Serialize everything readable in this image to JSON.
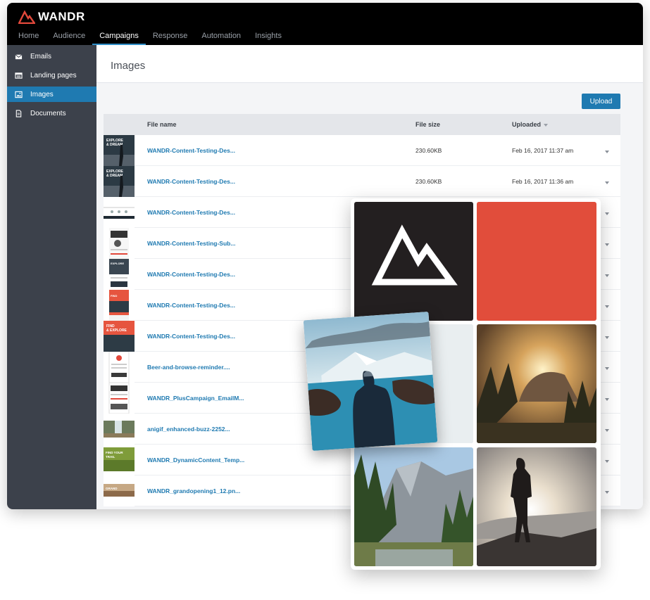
{
  "app": {
    "brand": "WANDR",
    "accent_color": "#1f7ab1",
    "brand_color": "#e1483b"
  },
  "topnav": {
    "items": [
      {
        "label": "Home",
        "active": false
      },
      {
        "label": "Audience",
        "active": false
      },
      {
        "label": "Campaigns",
        "active": true
      },
      {
        "label": "Response",
        "active": false
      },
      {
        "label": "Automation",
        "active": false
      },
      {
        "label": "Insights",
        "active": false
      }
    ]
  },
  "sidebar": {
    "items": [
      {
        "label": "Emails",
        "icon": "envelope-icon",
        "active": false
      },
      {
        "label": "Landing pages",
        "icon": "browser-page-icon",
        "active": false
      },
      {
        "label": "Images",
        "icon": "image-icon",
        "active": true
      },
      {
        "label": "Documents",
        "icon": "document-icon",
        "active": false
      }
    ]
  },
  "page": {
    "title": "Images",
    "upload_label": "Upload"
  },
  "table": {
    "columns": {
      "file_name": "File name",
      "file_size": "File size",
      "uploaded": "Uploaded"
    },
    "rows": [
      {
        "name": "WANDR-Content-Testing-Des...",
        "size": "230.60KB",
        "uploaded": "Feb 16, 2017 11:37 am",
        "thumb": "poster-explore"
      },
      {
        "name": "WANDR-Content-Testing-Des...",
        "size": "230.60KB",
        "uploaded": "Feb 16, 2017 11:36 am",
        "thumb": "poster-explore"
      },
      {
        "name": "WANDR-Content-Testing-Des...",
        "size": "",
        "uploaded": "",
        "thumb": "email-strip"
      },
      {
        "name": "WANDR-Content-Testing-Sub...",
        "size": "",
        "uploaded": "",
        "thumb": "email-long"
      },
      {
        "name": "WANDR-Content-Testing-Des...",
        "size": "",
        "uploaded": "",
        "thumb": "email-explore"
      },
      {
        "name": "WANDR-Content-Testing-Des...",
        "size": "",
        "uploaded": "",
        "thumb": "email-orange"
      },
      {
        "name": "WANDR-Content-Testing-Des...",
        "size": "",
        "uploaded": "",
        "thumb": "poster-orange"
      },
      {
        "name": "Beer-and-browse-reminder....",
        "size": "",
        "uploaded": "",
        "thumb": "email-white"
      },
      {
        "name": "WANDR_PlusCampaign_EmailM...",
        "size": "",
        "uploaded": "",
        "thumb": "email-dark"
      },
      {
        "name": "anigif_enhanced-buzz-2252...",
        "size": "",
        "uploaded": "",
        "thumb": "photo-waterfall"
      },
      {
        "name": "WANDR_DynamicContent_Temp...",
        "size": "",
        "uploaded": "",
        "thumb": "photo-green"
      },
      {
        "name": "WANDR_grandopening1_12.pn...",
        "size": "",
        "uploaded": "",
        "thumb": "photo-banner"
      }
    ]
  },
  "collage": {
    "tiles": [
      {
        "name": "logo-tile",
        "content": "mountain-logo-icon"
      },
      {
        "name": "red-tile",
        "content": "solid-color",
        "color": "#e14d3b"
      },
      {
        "name": "snowy-tile",
        "content": "photo"
      },
      {
        "name": "sunset-cliff-tile",
        "content": "photo"
      },
      {
        "name": "valley-tile",
        "content": "photo"
      },
      {
        "name": "hiker-tile",
        "content": "photo"
      },
      {
        "name": "lake-hiker-tile",
        "content": "photo"
      }
    ]
  }
}
